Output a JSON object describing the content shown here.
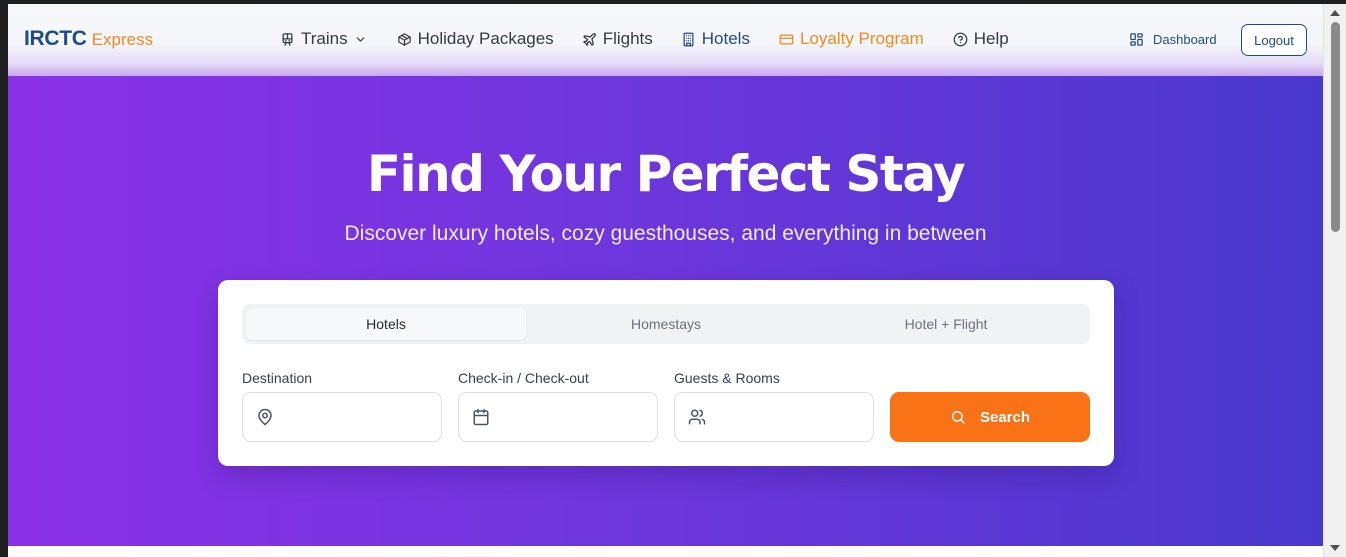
{
  "brand": {
    "main": "IRCTC",
    "sub": "Express"
  },
  "nav": {
    "trains": "Trains",
    "holiday": "Holiday Packages",
    "flights": "Flights",
    "hotels": "Hotels",
    "loyalty": "Loyalty Program",
    "help": "Help",
    "active": "Hotels"
  },
  "account": {
    "dashboard": "Dashboard",
    "logout": "Logout"
  },
  "hero": {
    "title": "Find Your Perfect Stay",
    "subtitle": "Discover luxury hotels, cozy guesthouses, and everything in between"
  },
  "search": {
    "tabs": [
      "Hotels",
      "Homestays",
      "Hotel + Flight"
    ],
    "selected_tab": "Hotels",
    "destination": {
      "label": "Destination",
      "value": ""
    },
    "dates": {
      "label": "Check-in / Check-out",
      "value": ""
    },
    "guests": {
      "label": "Guests & Rooms",
      "value": ""
    },
    "button": "Search"
  },
  "colors": {
    "brand_blue": "#1e4c8a",
    "accent_orange": "#f97316",
    "hero_gradient_start": "#8b31e8",
    "hero_gradient_end": "#4a38cd"
  },
  "icons": {
    "trains": "train-icon",
    "holiday": "package-icon",
    "flights": "plane-icon",
    "hotels": "building-icon",
    "loyalty": "credit-card-icon",
    "help": "help-circle-icon",
    "dashboard": "layout-dashboard-icon",
    "destination": "map-pin-icon",
    "dates": "calendar-icon",
    "guests": "users-icon",
    "search": "search-icon"
  }
}
